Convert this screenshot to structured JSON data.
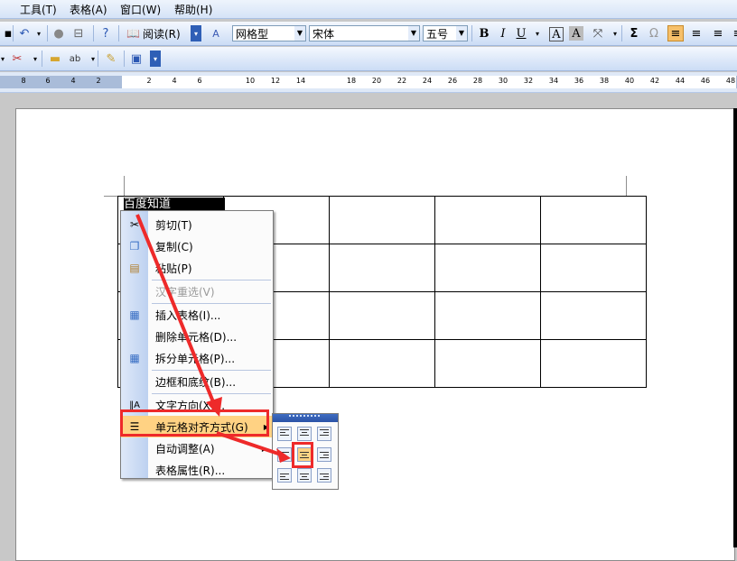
{
  "menu": {
    "tools": "工具(T)",
    "table": "表格(A)",
    "window": "窗口(W)",
    "help": "帮助(H)"
  },
  "toolbar": {
    "read_label": "阅读(R)",
    "style_value": "网格型",
    "font_value": "宋体",
    "size_value": "五号",
    "bold": "B",
    "italic": "I",
    "underline": "U",
    "border_a": "A",
    "shade_a": "A",
    "sigma": "Σ",
    "omega": "Ω"
  },
  "ruler": {
    "ticks": [
      "8",
      "6",
      "4",
      "2",
      "2",
      "4",
      "6",
      "10",
      "12",
      "14",
      "18",
      "20",
      "22",
      "24",
      "26",
      "28",
      "30",
      "32",
      "34",
      "36",
      "38",
      "40",
      "42",
      "44",
      "46",
      "48"
    ]
  },
  "document": {
    "selected_text": "百度知道"
  },
  "context_menu": {
    "items": [
      {
        "label": "剪切(T)",
        "icon": "scissors-icon",
        "disabled": false
      },
      {
        "label": "复制(C)",
        "icon": "copy-icon",
        "disabled": false
      },
      {
        "label": "粘贴(P)",
        "icon": "paste-icon",
        "disabled": false
      },
      {
        "label": "汉字重选(V)",
        "icon": "",
        "disabled": true
      },
      {
        "label": "插入表格(I)...",
        "icon": "insert-table-icon",
        "disabled": false
      },
      {
        "label": "删除单元格(D)...",
        "icon": "",
        "disabled": false
      },
      {
        "label": "拆分单元格(P)...",
        "icon": "split-cells-icon",
        "disabled": false
      },
      {
        "label": "边框和底纹(B)...",
        "icon": "",
        "disabled": false
      },
      {
        "label": "文字方向(X)...",
        "icon": "text-direction-icon",
        "disabled": false
      },
      {
        "label": "单元格对齐方式(G)",
        "icon": "cell-align-icon",
        "disabled": false
      },
      {
        "label": "自动调整(A)",
        "icon": "",
        "disabled": false
      },
      {
        "label": "表格属性(R)...",
        "icon": "",
        "disabled": false
      }
    ]
  },
  "colors": {
    "highlight": "#ffd283",
    "annotation": "#ee2a2a"
  }
}
